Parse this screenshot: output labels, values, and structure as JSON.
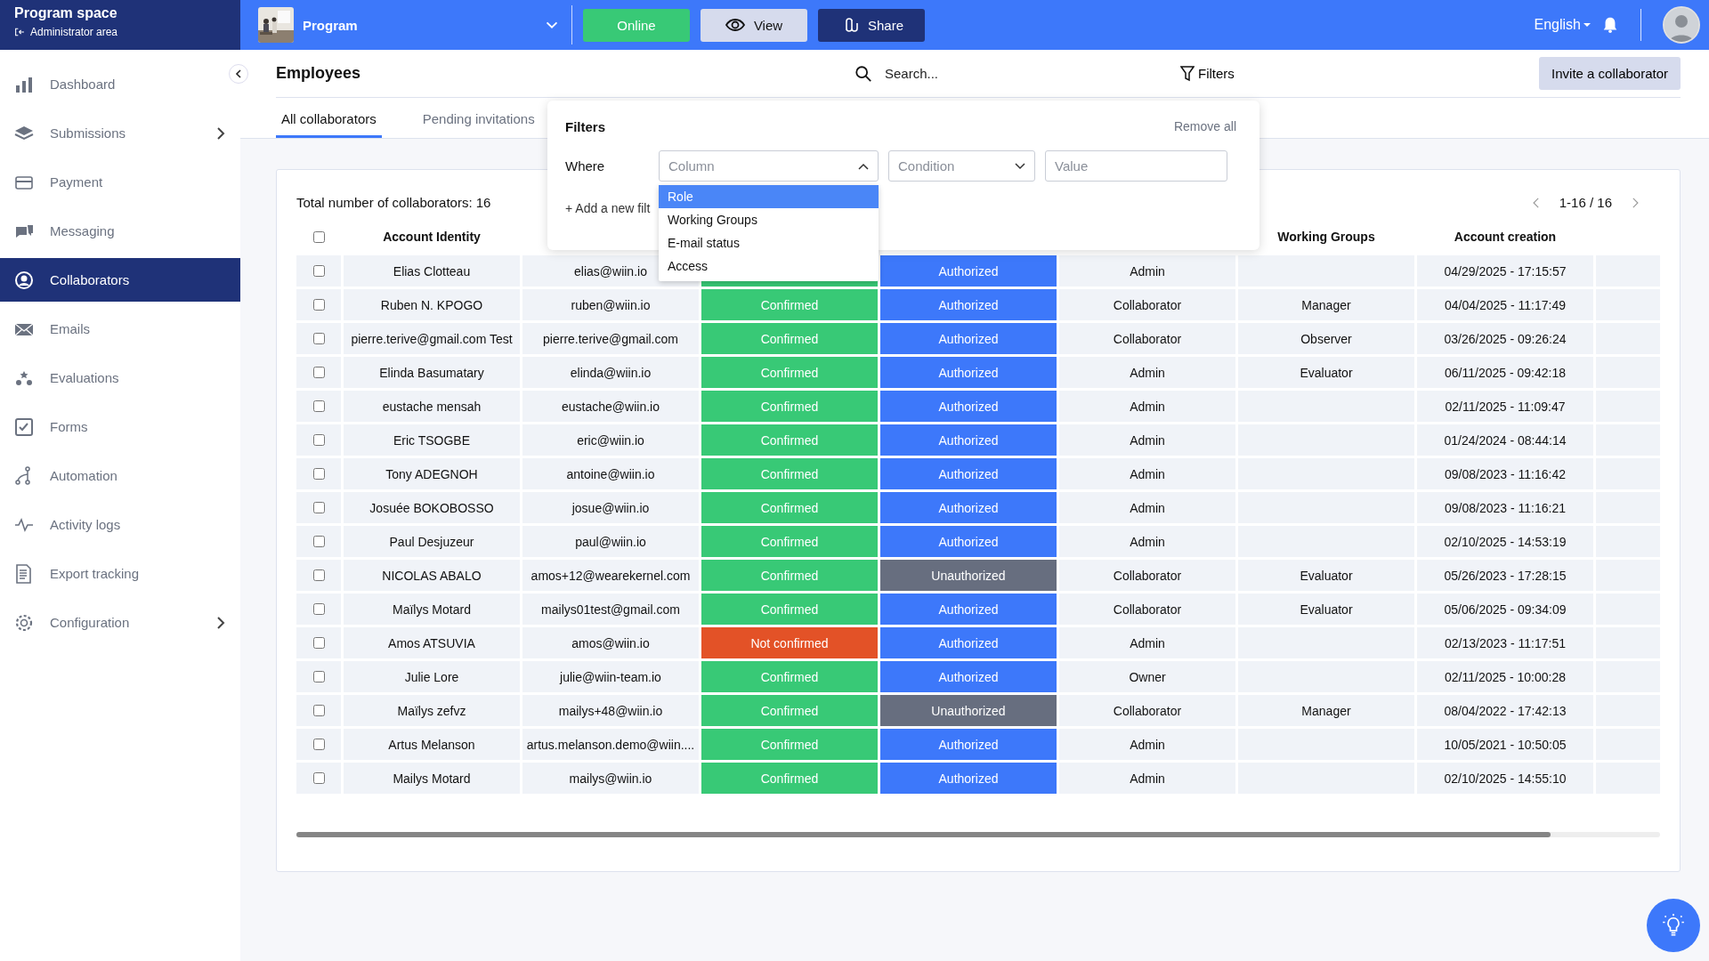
{
  "space": {
    "title": "Program space",
    "subtitle": "Administrator area"
  },
  "topbar": {
    "program": "Program",
    "buttons": [
      {
        "label": "Online",
        "kind": "online"
      },
      {
        "label": "View",
        "kind": "view"
      },
      {
        "label": "Share",
        "kind": "share"
      }
    ],
    "language": "English"
  },
  "sidebar": {
    "items": [
      {
        "label": "Dashboard",
        "selected": false,
        "has_submenu": false
      },
      {
        "label": "Submissions",
        "selected": false,
        "has_submenu": true
      },
      {
        "label": "Payment",
        "selected": false,
        "has_submenu": false
      },
      {
        "label": "Messaging",
        "selected": false,
        "has_submenu": false
      },
      {
        "label": "Collaborators",
        "selected": true,
        "has_submenu": false
      },
      {
        "label": "Emails",
        "selected": false,
        "has_submenu": false
      },
      {
        "label": "Evaluations",
        "selected": false,
        "has_submenu": false
      },
      {
        "label": "Forms",
        "selected": false,
        "has_submenu": false
      },
      {
        "label": "Automation",
        "selected": false,
        "has_submenu": false
      },
      {
        "label": "Activity logs",
        "selected": false,
        "has_submenu": false
      },
      {
        "label": "Export tracking",
        "selected": false,
        "has_submenu": false
      },
      {
        "label": "Configuration",
        "selected": false,
        "has_submenu": true
      }
    ]
  },
  "page": {
    "title": "Employees",
    "search": {
      "placeholder": "Search..."
    },
    "filters_label": "Filters",
    "invite_button": "Invite a collaborator"
  },
  "tabs": [
    {
      "label": "All collaborators",
      "selected": true
    },
    {
      "label": "Pending invitations",
      "selected": false
    }
  ],
  "filters_popup": {
    "title": "Filters",
    "remove_all": "Remove all",
    "where": "Where",
    "column": {
      "placeholder": "Column",
      "expanded": true
    },
    "condition": {
      "placeholder": "Condition"
    },
    "value": {
      "placeholder": "Value"
    },
    "add_filter": "+ Add a new filt",
    "options": [
      {
        "label": "Role",
        "selected": true
      },
      {
        "label": "Working Groups",
        "selected": false
      },
      {
        "label": "E-mail status",
        "selected": false
      },
      {
        "label": "Access",
        "selected": false
      }
    ]
  },
  "table": {
    "total": "Total number of collaborators: 16",
    "select_all_checked": false,
    "pagination": "1-16 / 16",
    "columns": [
      {
        "label": "Account Identity"
      },
      {},
      {},
      {},
      {},
      {
        "label": "Working Groups"
      },
      {
        "label": "Account creation"
      },
      {}
    ],
    "rows": [
      {
        "checked": false,
        "name": "Elias Clotteau",
        "email": "elias@wiin.io",
        "email_status": {
          "kind": "confirmed"
        },
        "access": {
          "kind": "authorized",
          "label": "Authorized"
        },
        "role": "Admin",
        "created": "04/29/2025 - 17:15:57"
      },
      {
        "checked": false,
        "name": "Ruben N. KPOGO",
        "email": "ruben@wiin.io",
        "email_status": {
          "kind": "confirmed",
          "label": "Confirmed"
        },
        "access": {
          "kind": "authorized",
          "label": "Authorized"
        },
        "role": "Collaborator",
        "group": "Manager",
        "created": "04/04/2025 - 11:17:49"
      },
      {
        "checked": false,
        "name": "pierre.terive@gmail.com Test",
        "email": "pierre.terive@gmail.com",
        "email_status": {
          "kind": "confirmed",
          "label": "Confirmed"
        },
        "access": {
          "kind": "authorized",
          "label": "Authorized"
        },
        "role": "Collaborator",
        "group": "Observer",
        "created": "03/26/2025 - 09:26:24"
      },
      {
        "checked": false,
        "name": "Elinda Basumatary",
        "email": "elinda@wiin.io",
        "email_status": {
          "kind": "confirmed",
          "label": "Confirmed"
        },
        "access": {
          "kind": "authorized",
          "label": "Authorized"
        },
        "role": "Admin",
        "group": "Evaluator",
        "created": "06/11/2025 - 09:42:18"
      },
      {
        "checked": false,
        "name": "eustache mensah",
        "email": "eustache@wiin.io",
        "email_status": {
          "kind": "confirmed",
          "label": "Confirmed"
        },
        "access": {
          "kind": "authorized",
          "label": "Authorized"
        },
        "role": "Admin",
        "created": "02/11/2025 - 11:09:47"
      },
      {
        "checked": false,
        "name": "Eric TSOGBE",
        "email": "eric@wiin.io",
        "email_status": {
          "kind": "confirmed",
          "label": "Confirmed"
        },
        "access": {
          "kind": "authorized",
          "label": "Authorized"
        },
        "role": "Admin",
        "created": "01/24/2024 - 08:44:14"
      },
      {
        "checked": false,
        "name": "Tony ADEGNOH",
        "email": "antoine@wiin.io",
        "email_status": {
          "kind": "confirmed",
          "label": "Confirmed"
        },
        "access": {
          "kind": "authorized",
          "label": "Authorized"
        },
        "role": "Admin",
        "created": "09/08/2023 - 11:16:42"
      },
      {
        "checked": false,
        "name": "Josuée BOKOBOSSO",
        "email": "josue@wiin.io",
        "email_status": {
          "kind": "confirmed",
          "label": "Confirmed"
        },
        "access": {
          "kind": "authorized",
          "label": "Authorized"
        },
        "role": "Admin",
        "created": "09/08/2023 - 11:16:21"
      },
      {
        "checked": false,
        "name": "Paul Desjuzeur",
        "email": "paul@wiin.io",
        "email_status": {
          "kind": "confirmed",
          "label": "Confirmed"
        },
        "access": {
          "kind": "authorized",
          "label": "Authorized"
        },
        "role": "Admin",
        "created": "02/10/2025 - 14:53:19"
      },
      {
        "checked": false,
        "name": "NICOLAS ABALO",
        "email": "amos+12@wearekernel.com",
        "email_status": {
          "kind": "confirmed",
          "label": "Confirmed"
        },
        "access": {
          "kind": "unauthorized",
          "label": "Unauthorized"
        },
        "role": "Collaborator",
        "group": "Evaluator",
        "created": "05/26/2023 - 17:28:15"
      },
      {
        "checked": false,
        "name": "Maïlys Motard",
        "email": "mailys01test@gmail.com",
        "email_status": {
          "kind": "confirmed",
          "label": "Confirmed"
        },
        "access": {
          "kind": "authorized",
          "label": "Authorized"
        },
        "role": "Collaborator",
        "group": "Evaluator",
        "created": "05/06/2025 - 09:34:09"
      },
      {
        "checked": false,
        "name": "Amos ATSUVIA",
        "email": "amos@wiin.io",
        "email_status": {
          "kind": "not_confirmed",
          "label": "Not confirmed"
        },
        "access": {
          "kind": "authorized",
          "label": "Authorized"
        },
        "role": "Admin",
        "created": "02/13/2023 - 11:17:51"
      },
      {
        "checked": false,
        "name": "Julie Lore",
        "email": "julie@wiin-team.io",
        "email_status": {
          "kind": "confirmed",
          "label": "Confirmed"
        },
        "access": {
          "kind": "authorized",
          "label": "Authorized"
        },
        "role": "Owner",
        "created": "02/11/2025 - 10:00:28"
      },
      {
        "checked": false,
        "name": "Maïlys zefvz",
        "email": "mailys+48@wiin.io",
        "email_status": {
          "kind": "confirmed",
          "label": "Confirmed"
        },
        "access": {
          "kind": "unauthorized",
          "label": "Unauthorized"
        },
        "role": "Collaborator",
        "group": "Manager",
        "created": "08/04/2022 - 17:42:13"
      },
      {
        "checked": false,
        "name": "Artus Melanson",
        "email": "artus.melanson.demo@wiin....",
        "email_status": {
          "kind": "confirmed",
          "label": "Confirmed"
        },
        "access": {
          "kind": "authorized",
          "label": "Authorized"
        },
        "role": "Admin",
        "created": "10/05/2021 - 10:50:05"
      },
      {
        "checked": false,
        "name": "Mailys Motard",
        "email": "mailys@wiin.io",
        "email_status": {
          "kind": "confirmed",
          "label": "Confirmed"
        },
        "access": {
          "kind": "authorized",
          "label": "Authorized"
        },
        "role": "Admin",
        "created": "02/10/2025 - 14:55:10"
      }
    ]
  }
}
